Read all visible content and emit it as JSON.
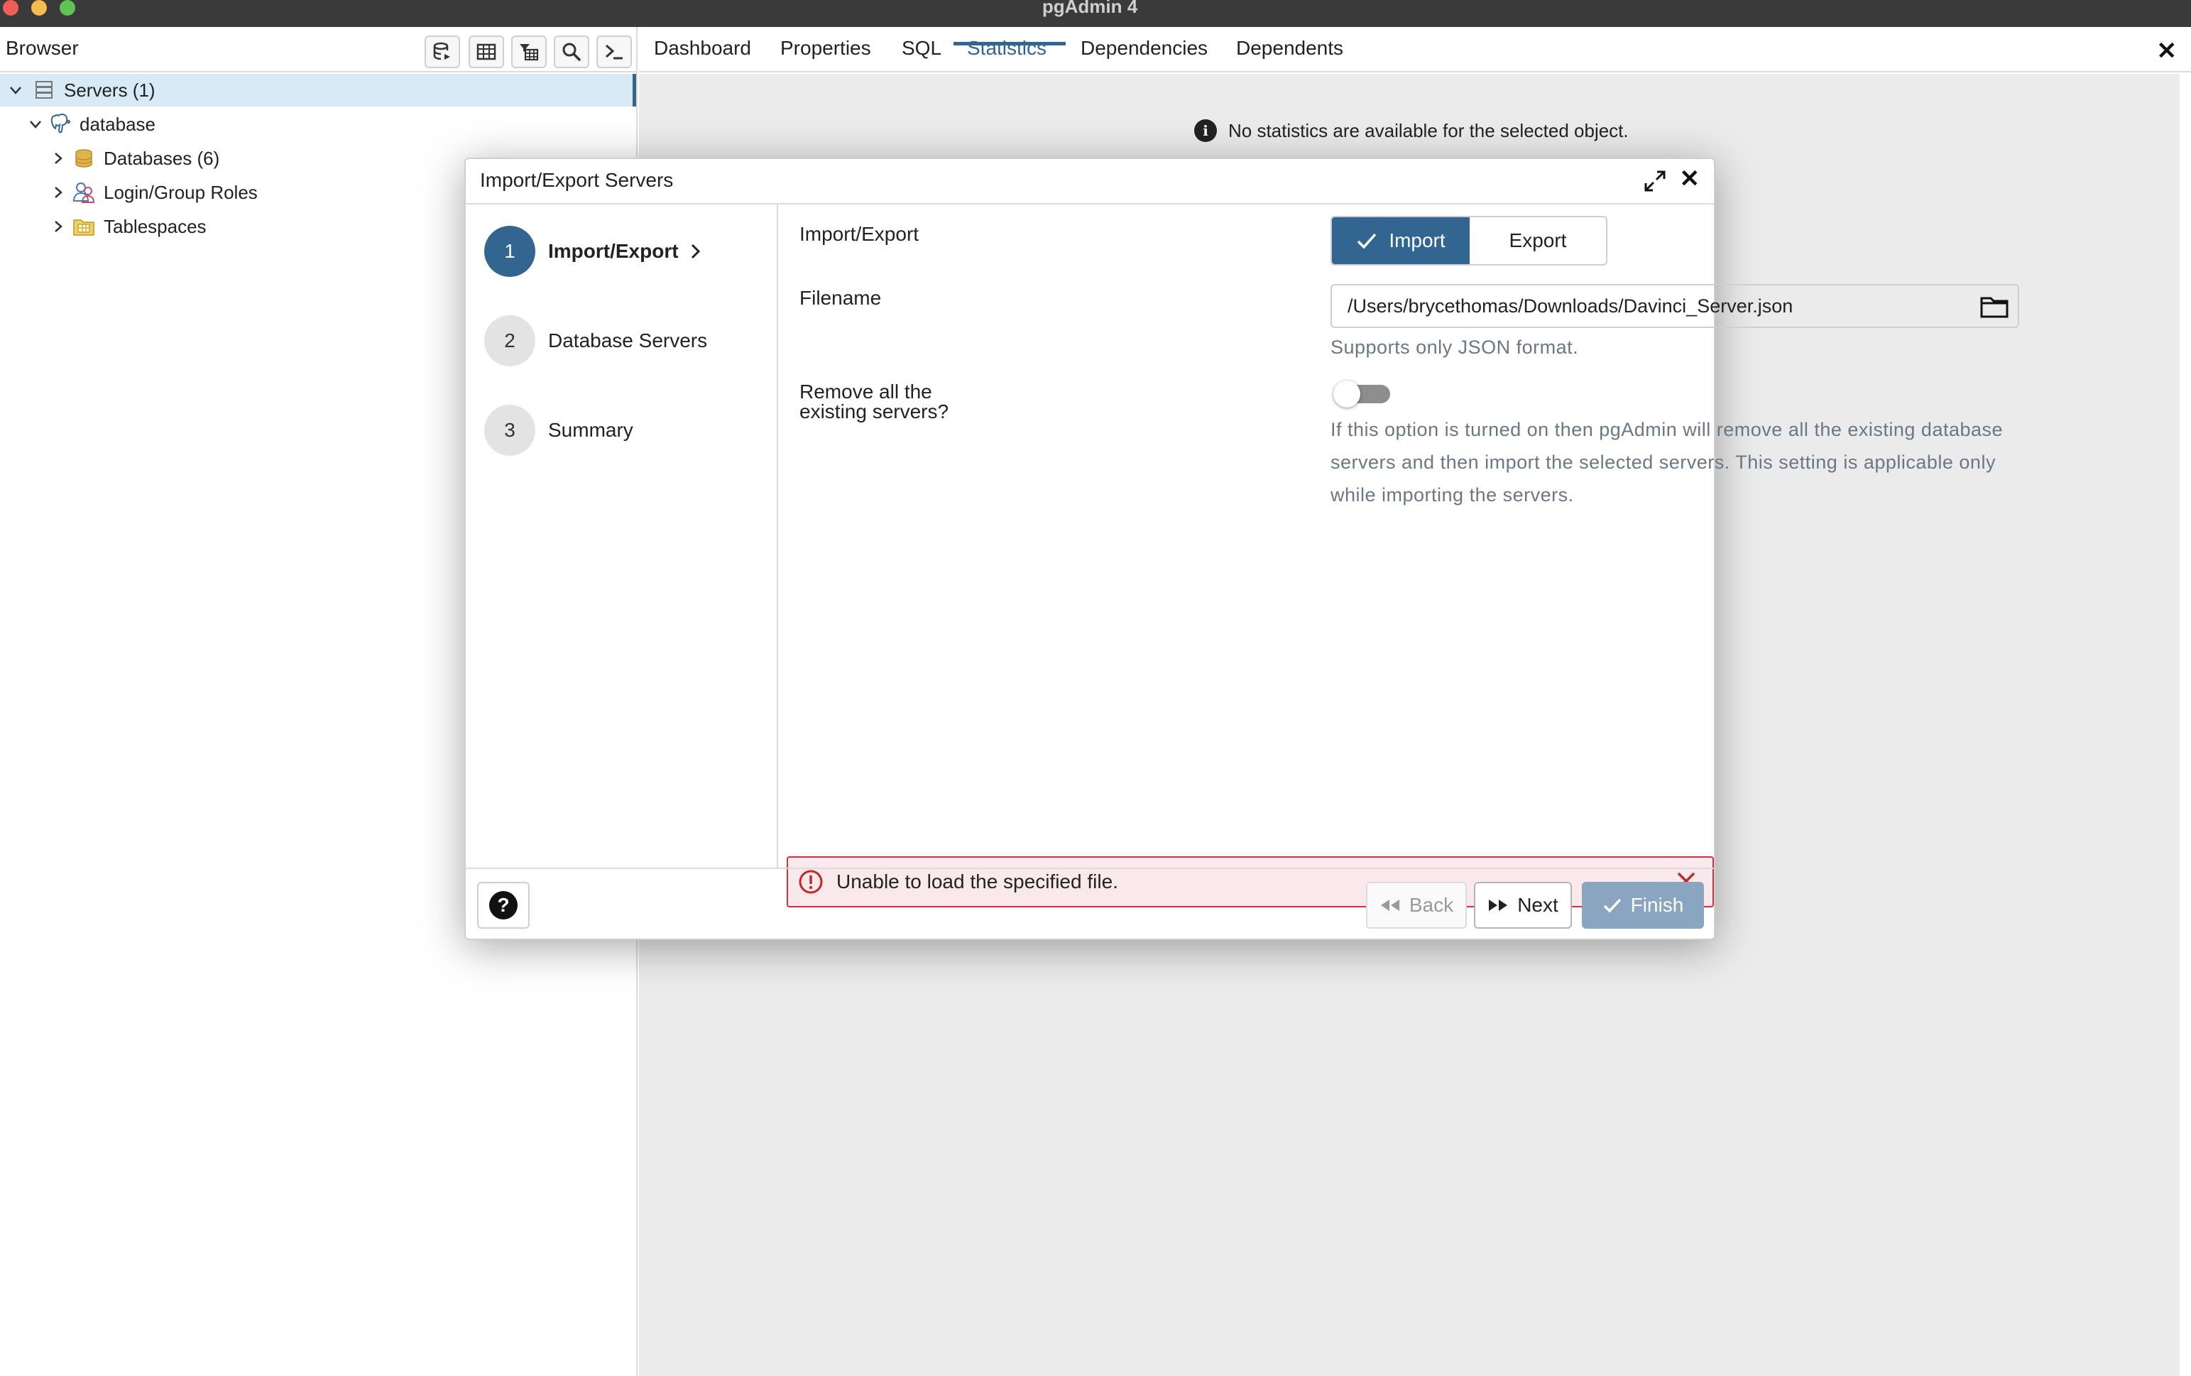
{
  "window": {
    "title": "pgAdmin 4"
  },
  "browser": {
    "title": "Browser",
    "toolbar": [
      "query-tool-icon",
      "table-view-icon",
      "filtered-rows-icon",
      "search-objects-icon",
      "psql-tool-icon"
    ],
    "tree": {
      "servers": "Servers (1)",
      "server": "database",
      "databases": "Databases (6)",
      "roles": "Login/Group Roles",
      "tablespaces": "Tablespaces"
    }
  },
  "tabs": [
    "Dashboard",
    "Properties",
    "SQL",
    "Statistics",
    "Dependencies",
    "Dependents"
  ],
  "active_tab": "Statistics",
  "content": {
    "no_stats": "No statistics are available for the selected object."
  },
  "dialog": {
    "title": "Import/Export Servers",
    "steps": [
      {
        "num": "1",
        "label": "Import/Export"
      },
      {
        "num": "2",
        "label": "Database Servers"
      },
      {
        "num": "3",
        "label": "Summary"
      }
    ],
    "form": {
      "mode_label": "Import/Export",
      "import_label": "Import",
      "export_label": "Export",
      "filename_label": "Filename",
      "filename_value": "/Users/brycethomas/Downloads/Davinci_Server.json",
      "filename_hint": "Supports only JSON format.",
      "remove_label_1": "Remove all the",
      "remove_label_2": "existing servers?",
      "remove_hint": "If this option is turned on then pgAdmin will remove all the existing database servers and then import the selected servers. This setting is applicable only while importing the servers."
    },
    "error": "Unable to load the specified file.",
    "footer": {
      "back": "Back",
      "next": "Next",
      "finish": "Finish"
    }
  },
  "colors": {
    "accent": "#326690",
    "error_border": "#d0313e",
    "error_bg": "#fae9ec"
  }
}
